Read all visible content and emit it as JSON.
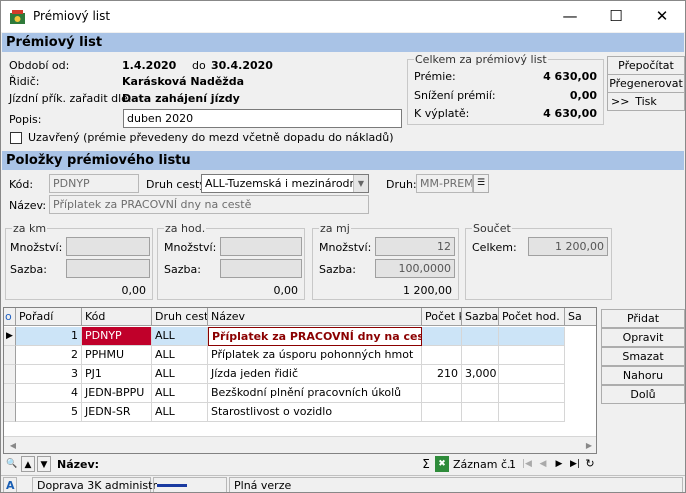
{
  "window": {
    "title": "Prémiový list"
  },
  "section1": {
    "title": "Prémiový list"
  },
  "info": {
    "period_label": "Období od:",
    "period_from": "1.4.2020",
    "period_to_label": "do",
    "period_to": "30.4.2020",
    "driver_label": "Řidič:",
    "driver": "Karásková Naděžda",
    "sort_label": "Jízdní přík. zařadit dle:",
    "sort": "Data zahájení jízdy",
    "desc_label": "Popis:",
    "desc": "duben 2020",
    "closed_label": "Uzavřený (prémie převedeny do mezd včetně dopadu do nákladů)"
  },
  "totals": {
    "title": "Celkem za prémiový list",
    "premie_label": "Prémie:",
    "premie": "4 630,00",
    "snizeni_label": "Snížení prémií:",
    "snizeni": "0,00",
    "vyplata_label": "K výplatě:",
    "vyplata": "4 630,00"
  },
  "sidebuttons": {
    "recalc": "Přepočítat",
    "regen": "Přegenerovat",
    "print": "Tisk",
    "print_prefix": ">>"
  },
  "section2": {
    "title": "Položky prémiového listu"
  },
  "item": {
    "code_label": "Kód:",
    "code": "PDNYP",
    "route_label": "Druh cesty:",
    "route": "ALL-Tuzemská i mezinárodní",
    "type_label": "Druh:",
    "type": "MM-PREM",
    "name_label": "Název:",
    "name": "Příplatek za  PRACOVNÍ dny na cestě"
  },
  "groups": {
    "km": {
      "title": "za km",
      "qty_label": "Množství:",
      "rate_label": "Sazba:",
      "total": "0,00"
    },
    "hod": {
      "title": "za hod.",
      "qty_label": "Množství:",
      "rate_label": "Sazba:",
      "total": "0,00"
    },
    "mj": {
      "title": "za mj",
      "qty_label": "Množství:",
      "qty": "12",
      "rate_label": "Sazba:",
      "rate": "100,0000",
      "total": "1 200,00"
    },
    "sum": {
      "title": "Součet",
      "total_label": "Celkem:",
      "total": "1 200,00"
    }
  },
  "grid": {
    "headers": [
      "Pořadí",
      "Kód",
      "Druh cesty",
      "Název",
      "Počet km",
      "Sazba za km",
      "Počet hod.",
      "Sa"
    ],
    "rows": [
      [
        "1",
        "PDNYP",
        "ALL",
        "Příplatek za  PRACOVNÍ dny na cestě",
        "",
        "",
        ""
      ],
      [
        "2",
        "PPHMU",
        "ALL",
        "Příplatek za úsporu pohonných hmot",
        "",
        "",
        ""
      ],
      [
        "3",
        "PJ1",
        "ALL",
        "Jízda jeden řidič",
        "210",
        "3,000",
        ""
      ],
      [
        "4",
        "JEDN-BPPU",
        "ALL",
        "Bezškodní plnění pracovních úkolů",
        "",
        "",
        ""
      ],
      [
        "5",
        "JEDN-SR",
        "ALL",
        "Starostlivost o vozidlo",
        "",
        "",
        ""
      ]
    ],
    "header_marker": "o"
  },
  "gridbuttons": {
    "add": "Přidat",
    "edit": "Opravit",
    "delete": "Smazat",
    "up": "Nahoru",
    "down": "Dolů"
  },
  "navbar": {
    "filter_label": "Název:",
    "record_label": "Záznam č.:",
    "record": "1"
  },
  "status": {
    "user": "Doprava 3K administr",
    "version": "Plná verze",
    "lang_marker": "A"
  }
}
